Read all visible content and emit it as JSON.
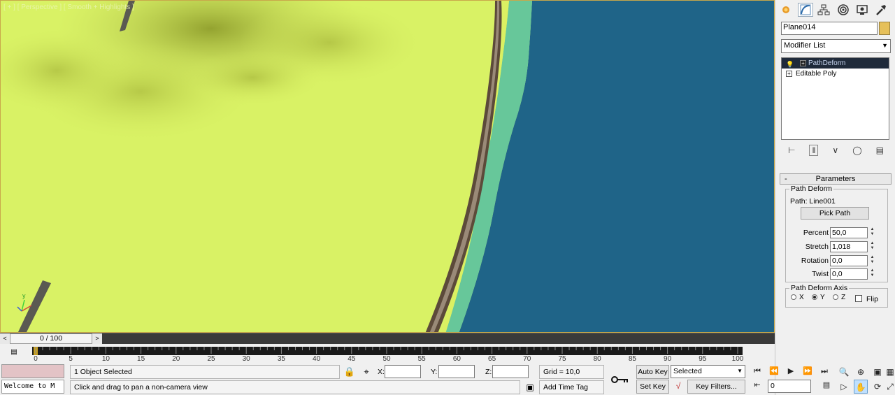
{
  "viewport": {
    "label": "[ + ] [ Perspective ] [ Smooth + Highlights ]",
    "axis_y": "y"
  },
  "command_panel": {
    "tabs": [
      "create-icon",
      "modify-icon",
      "hierarchy-icon",
      "motion-icon",
      "display-icon",
      "utilities-icon"
    ],
    "object_name": "Plane014",
    "object_color": "#e6c05a",
    "modifier_list": "Modifier List",
    "stack": [
      {
        "label": "PathDeform",
        "selected": true
      },
      {
        "label": "Editable Poly",
        "selected": false
      }
    ],
    "rollout_title": "Parameters",
    "rollout_minus": "-",
    "path_deform_group": "Path Deform",
    "path_text": "Path: Line001",
    "pick_path": "Pick Path",
    "percent_label": "Percent",
    "percent": "50,0",
    "stretch_label": "Stretch",
    "stretch": "1,018",
    "rotation_label": "Rotation",
    "rotation": "0,0",
    "twist_label": "Twist",
    "twist": "0,0",
    "axis_group": "Path Deform Axis",
    "axis_x": "X",
    "axis_y": "Y",
    "axis_z": "Z",
    "axis_selected": "Y",
    "flip": "Flip"
  },
  "time": {
    "slider_value": "0 / 100",
    "left_arrow": "<",
    "right_arrow": ">",
    "ticks": [
      0,
      5,
      10,
      15,
      20,
      25,
      30,
      35,
      40,
      45,
      50,
      55,
      60,
      65,
      70,
      75,
      80,
      85,
      90,
      95,
      100
    ]
  },
  "status": {
    "maxscript": "Welcome to M",
    "selection": "1 Object Selected",
    "prompt": "Click and drag to pan a non-camera view",
    "x_label": "X:",
    "y_label": "Y:",
    "z_label": "Z:",
    "grid": "Grid = 10,0",
    "add_time_tag": "Add Time Tag",
    "auto_key": "Auto Key",
    "set_key": "Set Key",
    "selected_dropdown": "Selected",
    "key_filters": "Key Filters...",
    "frame": "0"
  }
}
